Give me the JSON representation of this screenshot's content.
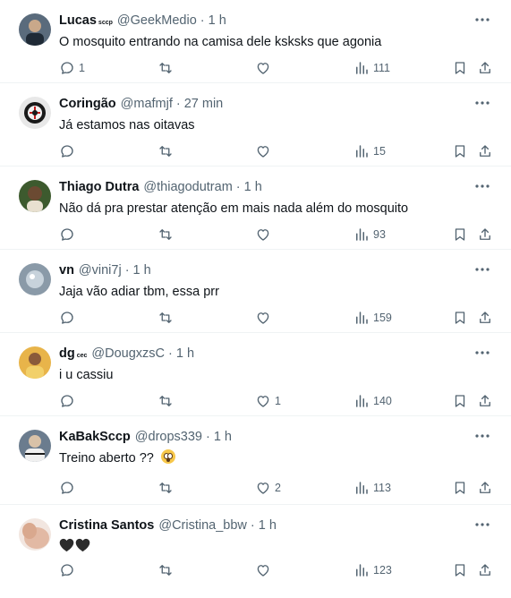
{
  "tweets": [
    {
      "name": "Lucas",
      "badge": "sccp",
      "handle": "@GeekMedio",
      "time": "1 h",
      "text": "O mosquito entrando na camisa dele ksksks que agonia",
      "replies": "1",
      "retweets": "",
      "likes": "",
      "views": "111",
      "avatar_color": "#5a6b7c"
    },
    {
      "name": "Coringão",
      "badge": "",
      "handle": "@mafmjf",
      "time": "27 min",
      "text": "Já estamos nas oitavas",
      "replies": "",
      "retweets": "",
      "likes": "",
      "views": "15",
      "avatar_color": "#e8e8e8"
    },
    {
      "name": "Thiago Dutra",
      "badge": "",
      "handle": "@thiagodutram",
      "time": "1 h",
      "text": "Não dá pra prestar atenção em mais nada além do mosquito",
      "replies": "",
      "retweets": "",
      "likes": "",
      "views": "93",
      "avatar_color": "#3d5a2e"
    },
    {
      "name": "vn",
      "badge": "",
      "handle": "@vini7j",
      "time": "1 h",
      "text": "Jaja vão adiar tbm, essa prr",
      "replies": "",
      "retweets": "",
      "likes": "",
      "views": "159",
      "avatar_color": "#8a9aa8"
    },
    {
      "name": "dg",
      "badge": "cec",
      "handle": "@DougxzsC",
      "time": "1 h",
      "text": "i u cassiu",
      "replies": "",
      "retweets": "",
      "likes": "1",
      "views": "140",
      "avatar_color": "#e8b44a"
    },
    {
      "name": "KaBakSccp",
      "badge": "",
      "handle": "@drops339",
      "time": "1 h",
      "text": "Treino aberto ??",
      "replies": "",
      "retweets": "",
      "likes": "2",
      "views": "113",
      "avatar_color": "#6b7c8e"
    },
    {
      "name": "Cristina Santos",
      "badge": "",
      "handle": "@Cristina_bbw",
      "time": "1 h",
      "text": "",
      "replies": "",
      "retweets": "",
      "likes": "",
      "views": "123",
      "avatar_color": "#e2b9a4"
    }
  ],
  "separator": "·",
  "icons": [
    "more-icon",
    "reply-icon",
    "retweet-icon",
    "like-icon",
    "views-icon",
    "bookmark-icon",
    "share-icon"
  ],
  "colors": {
    "text": "#0f1419",
    "muted": "#536471",
    "divider": "#eff3f4"
  }
}
